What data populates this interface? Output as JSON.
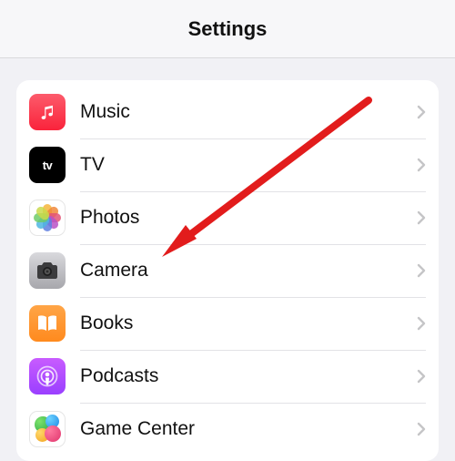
{
  "header": {
    "title": "Settings"
  },
  "rows": [
    {
      "label": "Music"
    },
    {
      "label": "TV"
    },
    {
      "label": "Photos"
    },
    {
      "label": "Camera"
    },
    {
      "label": "Books"
    },
    {
      "label": "Podcasts"
    },
    {
      "label": "Game Center"
    }
  ],
  "annotation": {
    "type": "arrow",
    "target_label": "Camera"
  }
}
